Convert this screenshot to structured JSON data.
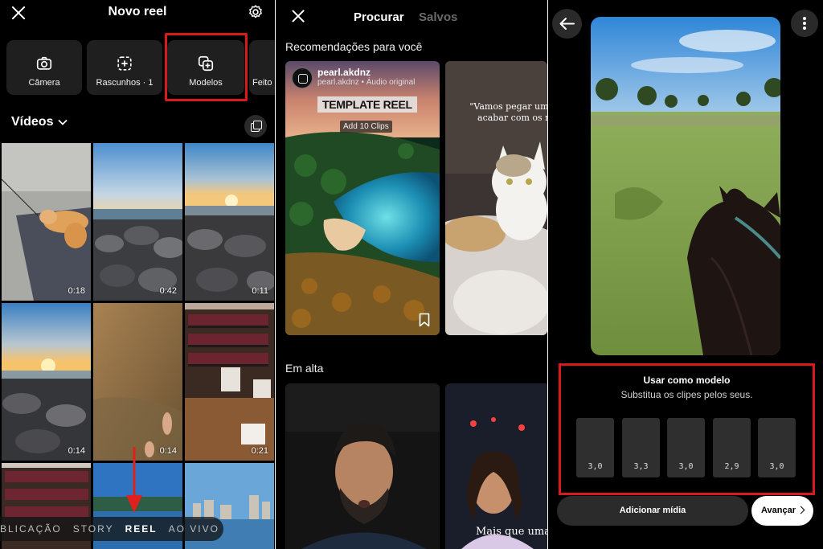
{
  "panel1": {
    "title": "Novo reel",
    "tools": [
      {
        "label": "Câmera",
        "icon": "camera-icon"
      },
      {
        "label": "Rascunhos · 1",
        "icon": "drafts-icon"
      },
      {
        "label": "Modelos",
        "icon": "templates-icon"
      },
      {
        "label": "Feito",
        "icon": "made-for-you-icon"
      }
    ],
    "videos_label": "Vídeos",
    "thumbs": [
      {
        "duration": "0:18"
      },
      {
        "duration": "0:42"
      },
      {
        "duration": "0:11"
      },
      {
        "duration": "0:14"
      },
      {
        "duration": "0:14"
      },
      {
        "duration": "0:21"
      },
      {
        "duration": ""
      },
      {
        "duration": ""
      },
      {
        "duration": ""
      }
    ],
    "modes": [
      "BLICAÇÃO",
      "STORY",
      "REEL",
      "AO VIVO"
    ],
    "active_mode": "REEL",
    "highlight_color": "#d91a1a"
  },
  "panel2": {
    "tab_browse": "Procurar",
    "tab_saved": "Salvos",
    "section_recommended": "Recomendações para você",
    "card1": {
      "username": "pearl.akdnz",
      "subtitle": "pearl.akdnz • Áudio original",
      "template_title": "TEMPLATE REEL",
      "clips_label": "Add 10 Clips"
    },
    "card2": {
      "quote": "\"Vamos pegar um ga acabar com os ra"
    },
    "section_trending": "Em alta",
    "card4": {
      "caption": "Mais que uma fi"
    }
  },
  "panel3": {
    "use_title": "Usar como modelo",
    "use_subtitle": "Substitua os clipes pelos seus.",
    "clips": [
      "3,0",
      "3,3",
      "3,0",
      "2,9",
      "3,0"
    ],
    "add_media": "Adicionar mídia",
    "advance": "Avançar"
  }
}
